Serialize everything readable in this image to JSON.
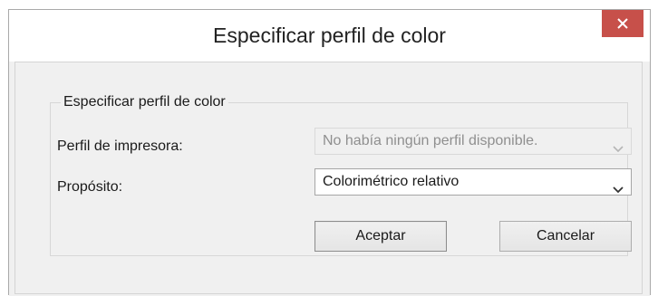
{
  "window": {
    "title": "Especificar perfil de color",
    "close_icon": "close-icon"
  },
  "group": {
    "legend": "Especificar perfil de color"
  },
  "fields": {
    "printer_profile_label": "Perfil de impresora:",
    "printer_profile_value": "No había ningún perfil disponible.",
    "purpose_label": "Propósito:",
    "purpose_value": "Colorimétrico relativo"
  },
  "buttons": {
    "accept_label": "Aceptar",
    "cancel_label": "Cancelar"
  },
  "colors": {
    "close_button_bg": "#c7504a",
    "dialog_bg": "#f0f0f0",
    "titlebar_bg": "#ffffff"
  }
}
